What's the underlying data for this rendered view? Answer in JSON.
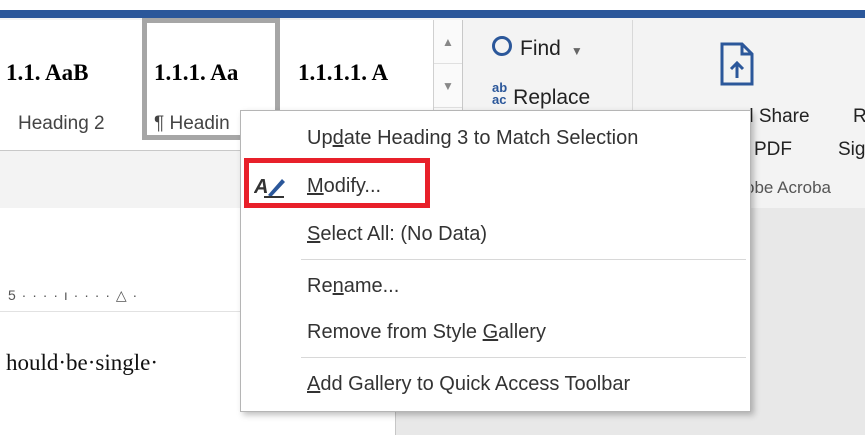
{
  "window": {
    "accent_color": "#2b579a"
  },
  "styles_gallery": {
    "items": [
      {
        "preview": "1.1.  AaB",
        "name": "Heading 2"
      },
      {
        "preview": "1.1.1.  Aa",
        "name": "¶ Headin"
      },
      {
        "preview": "1.1.1.1.  A",
        "name": ""
      }
    ],
    "scroll_up_icon": "triangle-up",
    "scroll_down_icon": "triangle-down"
  },
  "editing": {
    "find_label": "Find",
    "replace_label": "Replace",
    "replace_icon_text": "ab→ac"
  },
  "acrobat": {
    "create_share_line1": "d Share",
    "create_share_line2": "PDF",
    "request_line1": "R",
    "request_line2": "Sig",
    "group_label": "obe Acroba",
    "icon": "pdf-share-icon"
  },
  "ruler": {
    "text": "5 · · · · ı · · · · △ ·"
  },
  "document": {
    "visible_text": "hould·be·single·"
  },
  "context_menu": {
    "items": [
      {
        "id": "update",
        "pre": "Up",
        "underline": "d",
        "post": "ate Heading 3 to Match Selection"
      },
      {
        "id": "modify",
        "pre": "",
        "underline": "M",
        "post": "odify..."
      },
      {
        "id": "select_all",
        "pre": "",
        "underline": "S",
        "post": "elect All: (No Data)"
      },
      {
        "id": "rename",
        "pre": "Re",
        "underline": "n",
        "post": "ame..."
      },
      {
        "id": "remove",
        "pre": "Remove from Style ",
        "underline": "G",
        "post": "allery"
      },
      {
        "id": "add_gallery",
        "pre": "",
        "underline": "A",
        "post": "dd Gallery to Quick Access Toolbar"
      }
    ],
    "highlight_color": "#e8202a"
  }
}
